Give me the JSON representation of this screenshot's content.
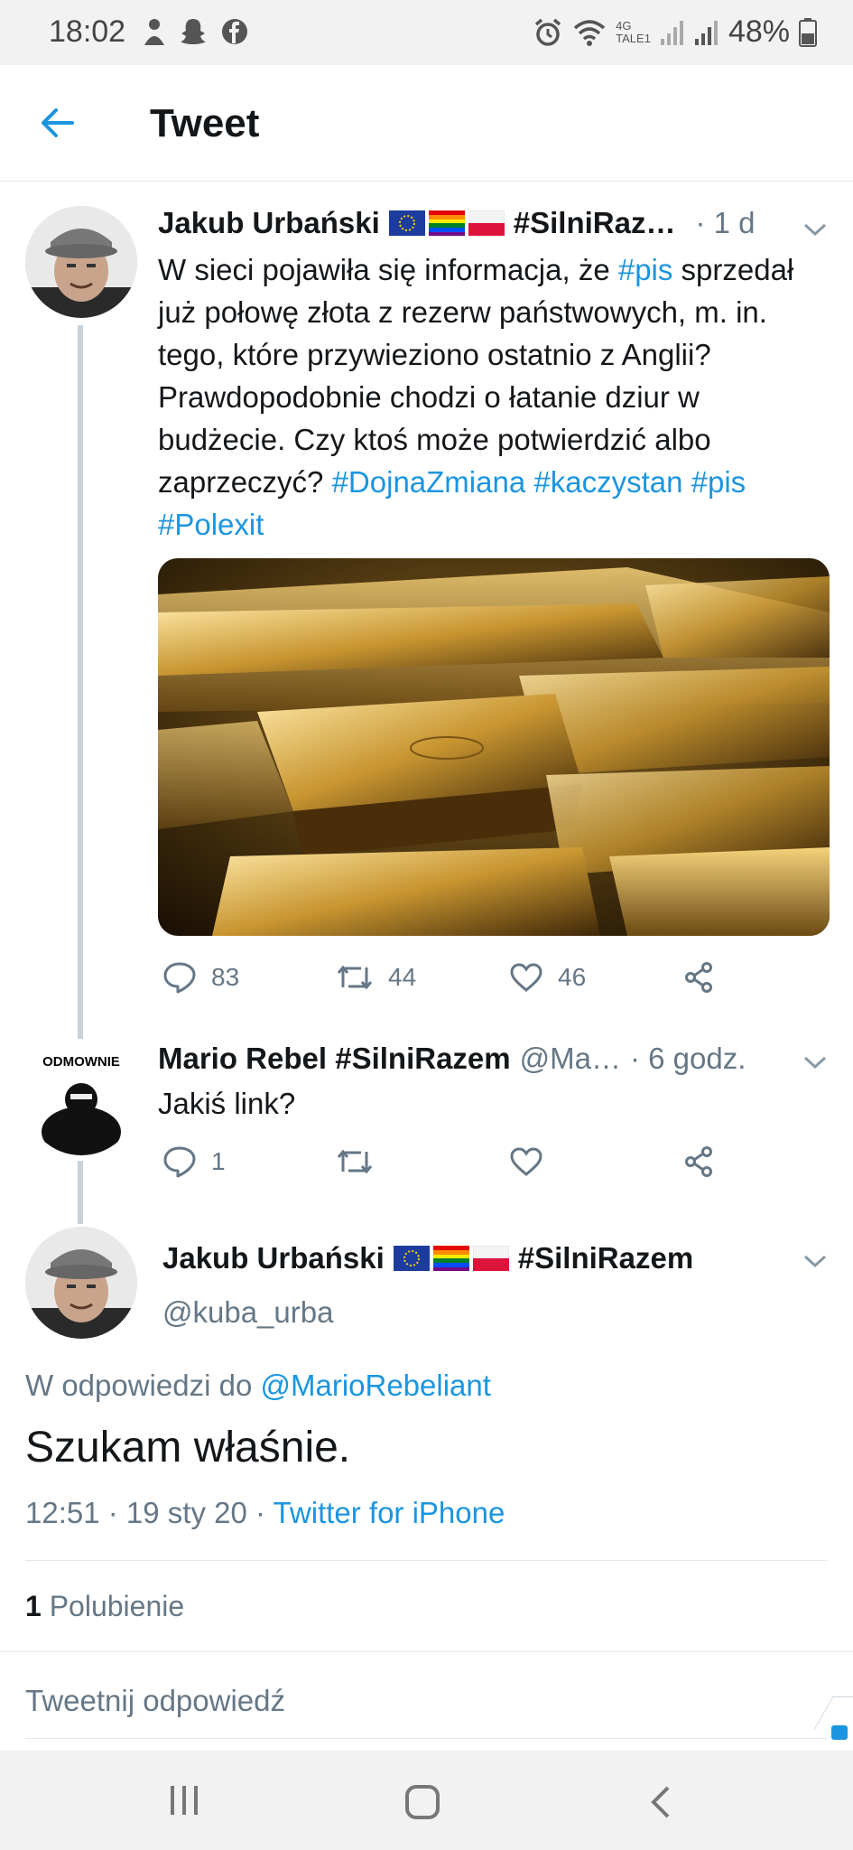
{
  "status_bar": {
    "time": "18:02",
    "network": "4G",
    "carrier": "TALE1",
    "battery": "48%",
    "icons": [
      "person-icon",
      "snapchat-icon",
      "facebook-icon",
      "alarm-icon",
      "wifi-icon",
      "signal-icon",
      "battery-icon"
    ]
  },
  "header": {
    "title": "Tweet",
    "back_icon": "arrow-left-icon"
  },
  "tweet1": {
    "name": "Jakub Urbański",
    "hashtag_name": "#SilniRaz…",
    "time": "· 1 d",
    "text_parts": {
      "t1": "W sieci pojawiła się informacja, że ",
      "h1": "#pis",
      "t2": " sprzedał już połowę złota z rezerw państwowych, m. in. tego, które przywieziono ostatnio z Anglii? Prawdopodobnie chodzi o łatanie dziur w budżecie. Czy ktoś może potwierdzić albo zaprzeczyć? ",
      "h2": "#DojnaZmiana",
      "h3": "#kaczystan",
      "h4": "#pis",
      "h5": "#Polexit"
    },
    "replies": "83",
    "retweets": "44",
    "likes": "46"
  },
  "tweet2": {
    "name": "Mario Rebel #SilniRazem",
    "handle": "@Ma…",
    "time": "· 6 godz.",
    "text": "Jakiś link?",
    "replies": "1",
    "avatar_text": "ODMOWNIE"
  },
  "main_tweet": {
    "name": "Jakub Urbański",
    "hashtag_name": "#SilniRazem",
    "handle": "@kuba_urba",
    "reply_prefix": "W odpowiedzi do",
    "reply_to": "@MarioRebeliant",
    "text": "Szukam właśnie.",
    "timestamp": "12:51 · 19 sty 20 ·",
    "source": "Twitter for iPhone",
    "likes_count": "1",
    "likes_label": "Polubienie",
    "reply_placeholder": "Tweetnij odpowiedź"
  },
  "nav": [
    "recents-icon",
    "home-icon",
    "back-icon"
  ],
  "colors": {
    "accent": "#1b95e0",
    "text": "#14171a",
    "muted": "#657786",
    "line": "#c7d3dc"
  }
}
